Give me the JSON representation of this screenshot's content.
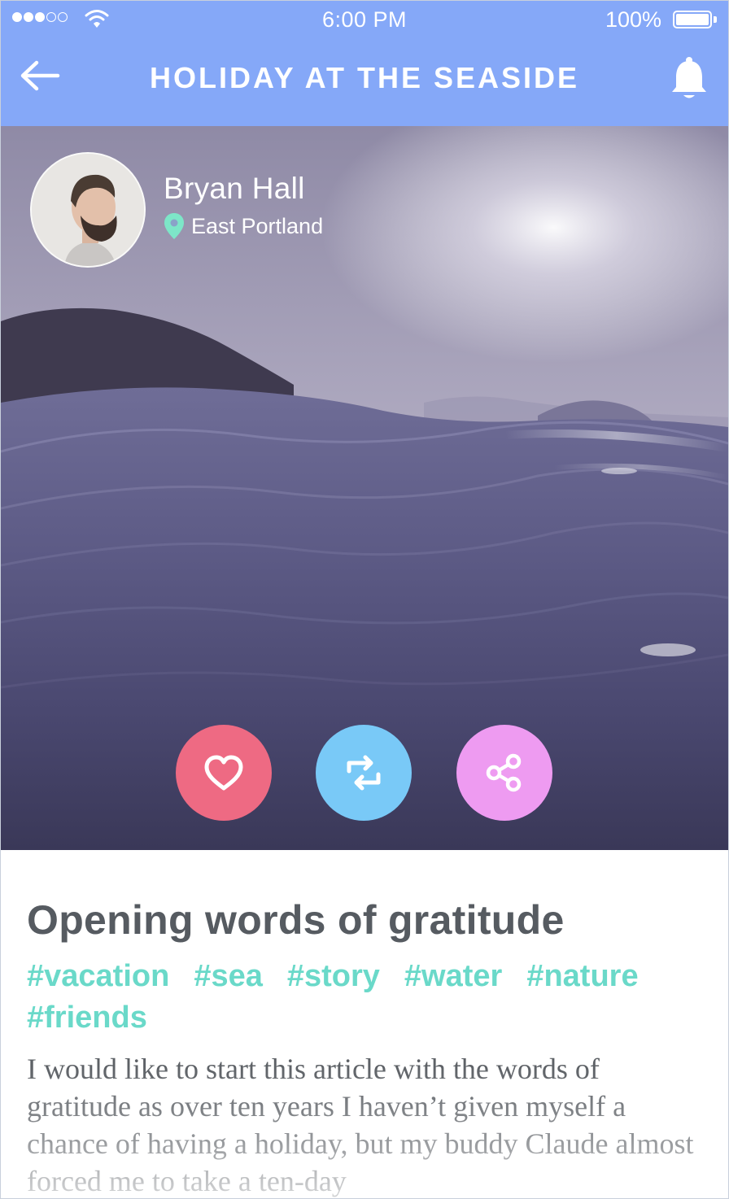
{
  "status_bar": {
    "time": "6:00 PM",
    "battery_percent": "100%",
    "signal_bars_filled": 3,
    "signal_bars_total": 5
  },
  "nav": {
    "title": "HOLIDAY AT THE SEASIDE",
    "back_icon": "arrow-left-icon",
    "notification_icon": "bell-icon"
  },
  "post": {
    "author_name": "Bryan Hall",
    "location": "East Portland",
    "location_icon": "map-pin-icon",
    "actions": [
      {
        "name": "like",
        "icon": "heart-icon",
        "color": "#ee6a83"
      },
      {
        "name": "repost",
        "icon": "repost-icon",
        "color": "#79c9f7"
      },
      {
        "name": "share",
        "icon": "share-icon",
        "color": "#ee9bf1"
      }
    ]
  },
  "article": {
    "title": "Opening words of gratitude",
    "tags": [
      "#vacation",
      "#sea",
      "#story",
      "#water",
      "#nature",
      "#friends"
    ],
    "body": "I would like to start this article with the words of gratitude as over ten years I haven’t given myself a chance of having a holiday, but my buddy Claude almost forced me to take a ten-day"
  },
  "colors": {
    "header": "#85a8f8",
    "tag": "#6ad9c9",
    "title": "#565b61",
    "body": "#5d6166",
    "location_pin": "#7de6c8"
  }
}
